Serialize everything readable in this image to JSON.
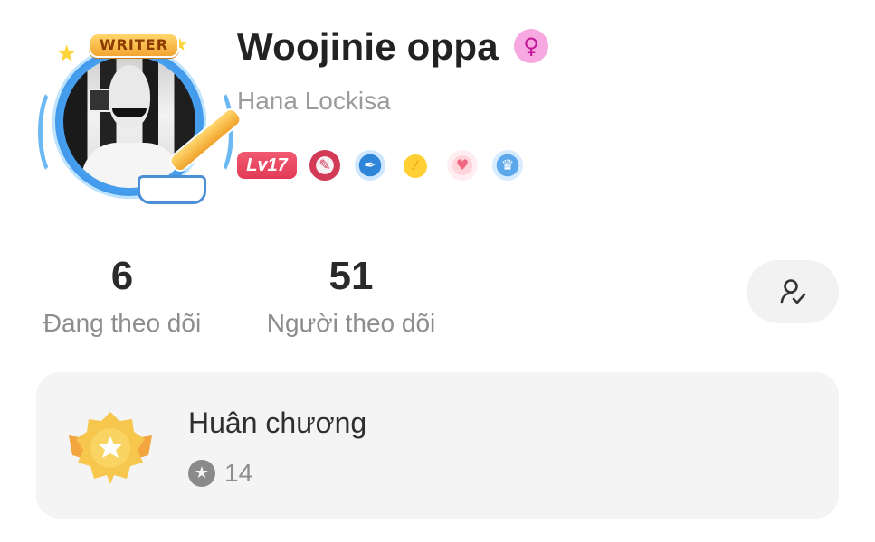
{
  "profile": {
    "avatar_banner": "WRITER",
    "display_name": "Woojinie oppa",
    "gender_icon": "♀",
    "username": "Hana Lockisa",
    "level": "Lv17"
  },
  "badges": [
    {
      "icon": "bunny-badge-icon"
    },
    {
      "icon": "pen-badge-icon"
    },
    {
      "icon": "coin-badge-icon"
    },
    {
      "icon": "heart-badge-icon"
    },
    {
      "icon": "crown-badge-icon"
    }
  ],
  "stats": {
    "following_count": "6",
    "following_label": "Đang theo dõi",
    "followers_count": "51",
    "followers_label": "Người theo dõi"
  },
  "medals": {
    "title": "Huân chương",
    "count": "14"
  },
  "colors": {
    "level_badge": "#e23a57",
    "gender_bg": "#f7a8e0",
    "card_bg": "#f4f4f4",
    "name_text": "#222222",
    "secondary_text": "#8d8d8d"
  }
}
